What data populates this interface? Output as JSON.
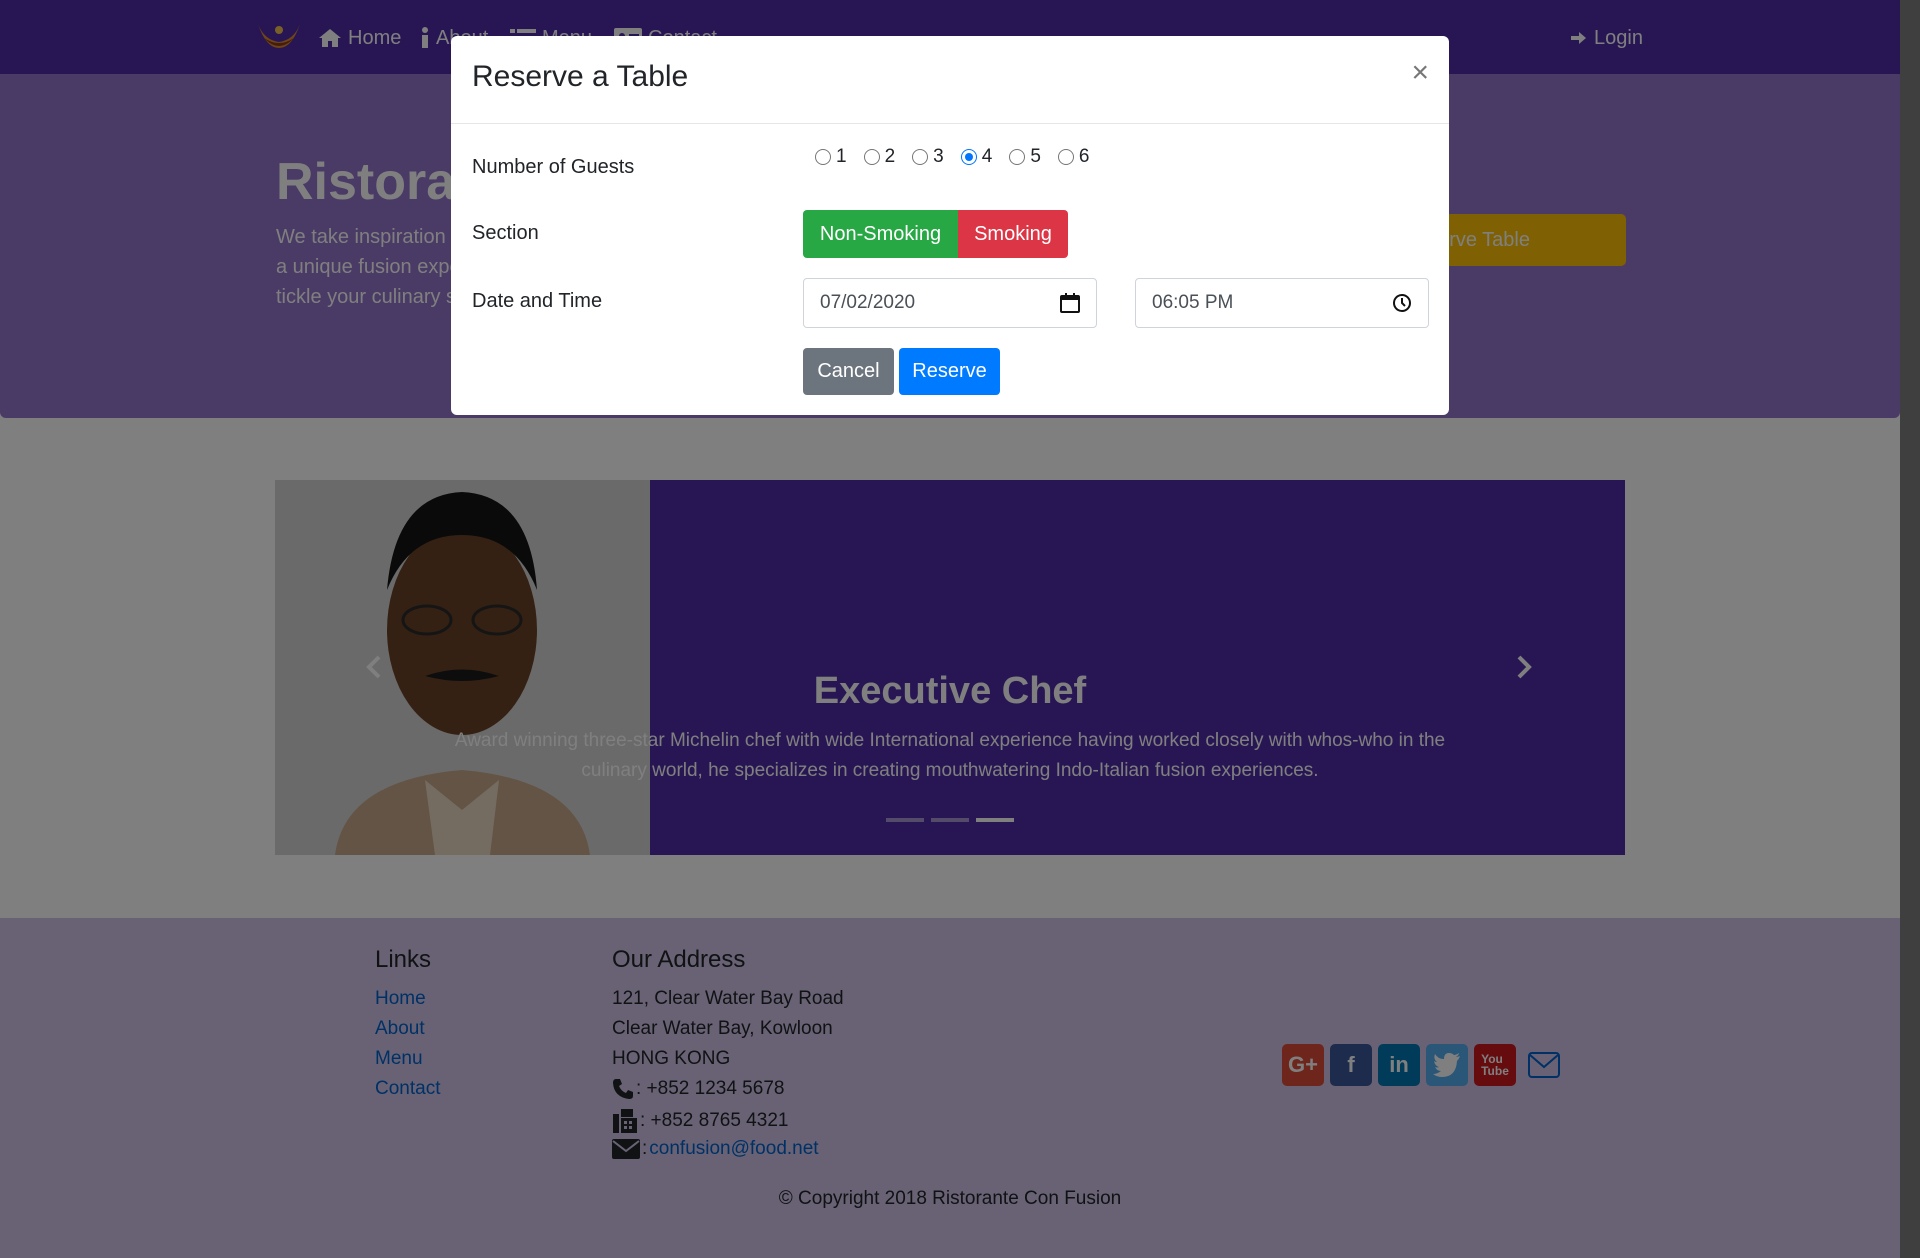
{
  "navbar": {
    "items": [
      {
        "label": "Home",
        "icon": "home-icon"
      },
      {
        "label": "About",
        "icon": "info-icon"
      },
      {
        "label": "Menu",
        "icon": "list-icon"
      },
      {
        "label": "Contact",
        "icon": "address-card-icon"
      }
    ],
    "login_label": "Login"
  },
  "jumbotron": {
    "title": "Ristorante con Fusion",
    "text": "We take inspiration from the World's best cuisines, and create a unique fusion experience. Our lipsmacking creations will tickle your culinary senses!",
    "button_label": "Reserve Table"
  },
  "carousel": {
    "title": "Executive Chef",
    "text": "Award winning three-star Michelin chef with wide International experience having worked closely with whos-who in the culinary world, he specializes in creating mouthwatering Indo-Italian fusion experiences.",
    "active_index": 2
  },
  "footer": {
    "links_heading": "Links",
    "links": [
      "Home",
      "About",
      "Menu",
      "Contact"
    ],
    "address_heading": "Our Address",
    "address_lines": [
      "121, Clear Water Bay Road",
      "Clear Water Bay, Kowloon",
      "HONG KONG"
    ],
    "phone": ": +852 1234 5678",
    "fax": ": +852 8765 4321",
    "email_prefix": ":",
    "email": "confusion@food.net",
    "copyright": "© Copyright 2018 Ristorante Con Fusion"
  },
  "modal": {
    "title": "Reserve a Table",
    "close": "×",
    "guests_label": "Number of Guests",
    "guest_options": [
      "1",
      "2",
      "3",
      "4",
      "5",
      "6"
    ],
    "selected_guests": "4",
    "section_label": "Section",
    "section_options": [
      "Non-Smoking",
      "Smoking"
    ],
    "datetime_label": "Date and Time",
    "date_value": "07/02/2020",
    "time_value": "06:05 PM",
    "cancel_label": "Cancel",
    "reserve_label": "Reserve"
  },
  "colors": {
    "primary": "#512DA8",
    "jumbotron": "#9575CD",
    "footer": "#D1C4E9",
    "success": "#28a745",
    "danger": "#dc3545",
    "reserve": "#007bff",
    "warning": "#FFC107"
  }
}
